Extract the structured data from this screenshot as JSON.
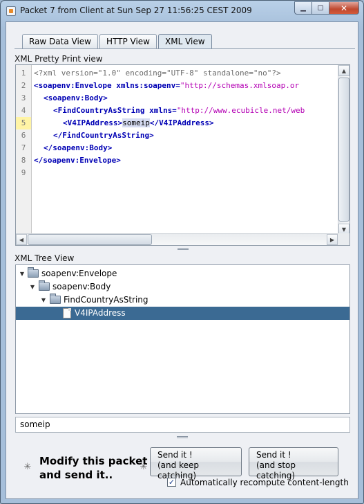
{
  "window": {
    "title": "Packet 7 from Client at Sun Sep 27 11:56:25 CEST 2009"
  },
  "tabs": [
    {
      "label": "Raw Data View"
    },
    {
      "label": "HTTP View"
    },
    {
      "label": "XML View"
    }
  ],
  "xml_view": {
    "pretty_label": "XML Pretty Print view",
    "line_numbers": [
      "1",
      "2",
      "3",
      "4",
      "5",
      "6",
      "7",
      "8",
      "9"
    ],
    "current_line": "5",
    "lines": {
      "l1": "<?xml version=\"1.0\" encoding=\"UTF-8\" standalone=\"no\"?>",
      "l2_tag": "<soapenv:Envelope xmlns:soapenv=",
      "l2_val": "\"http://schemas.xmlsoap.or",
      "l3_tag": "<soapenv:Body>",
      "l4_tag": "<FindCountryAsString xmlns=",
      "l4_val": "\"http://www.ecubicle.net/web",
      "l5_open": "<V4IPAddress>",
      "l5_text": "someip",
      "l5_close": "</V4IPAddress>",
      "l6_tag": "</FindCountryAsString>",
      "l7_tag": "</soapenv:Body>",
      "l8_tag": "</soapenv:Envelope>"
    },
    "tree_label": "XML Tree View",
    "tree": [
      {
        "label": "soapenv:Envelope"
      },
      {
        "label": "soapenv:Body"
      },
      {
        "label": "FindCountryAsString"
      },
      {
        "label": "V4IPAddress"
      }
    ],
    "value": "someip"
  },
  "footer": {
    "modify_line1": "Modify this packet",
    "modify_line2": "and send it..",
    "send_keep_line1": "Send it !",
    "send_keep_line2": "(and keep catching)",
    "send_stop_line1": "Send it !",
    "send_stop_line2": "(and stop catching)",
    "auto_recompute_label": "Automatically recompute content-length",
    "auto_recompute_checked": true
  },
  "colors": {
    "selection": "#3b6a93",
    "tag": "#0000b4",
    "attr_value": "#b400b4",
    "current_line": "#fff4a5"
  },
  "icons": [
    "app-icon",
    "minimize-icon",
    "maximize-icon",
    "close-icon",
    "folder-icon",
    "file-icon",
    "busy-spinner-icon",
    "checkmark-icon"
  ]
}
